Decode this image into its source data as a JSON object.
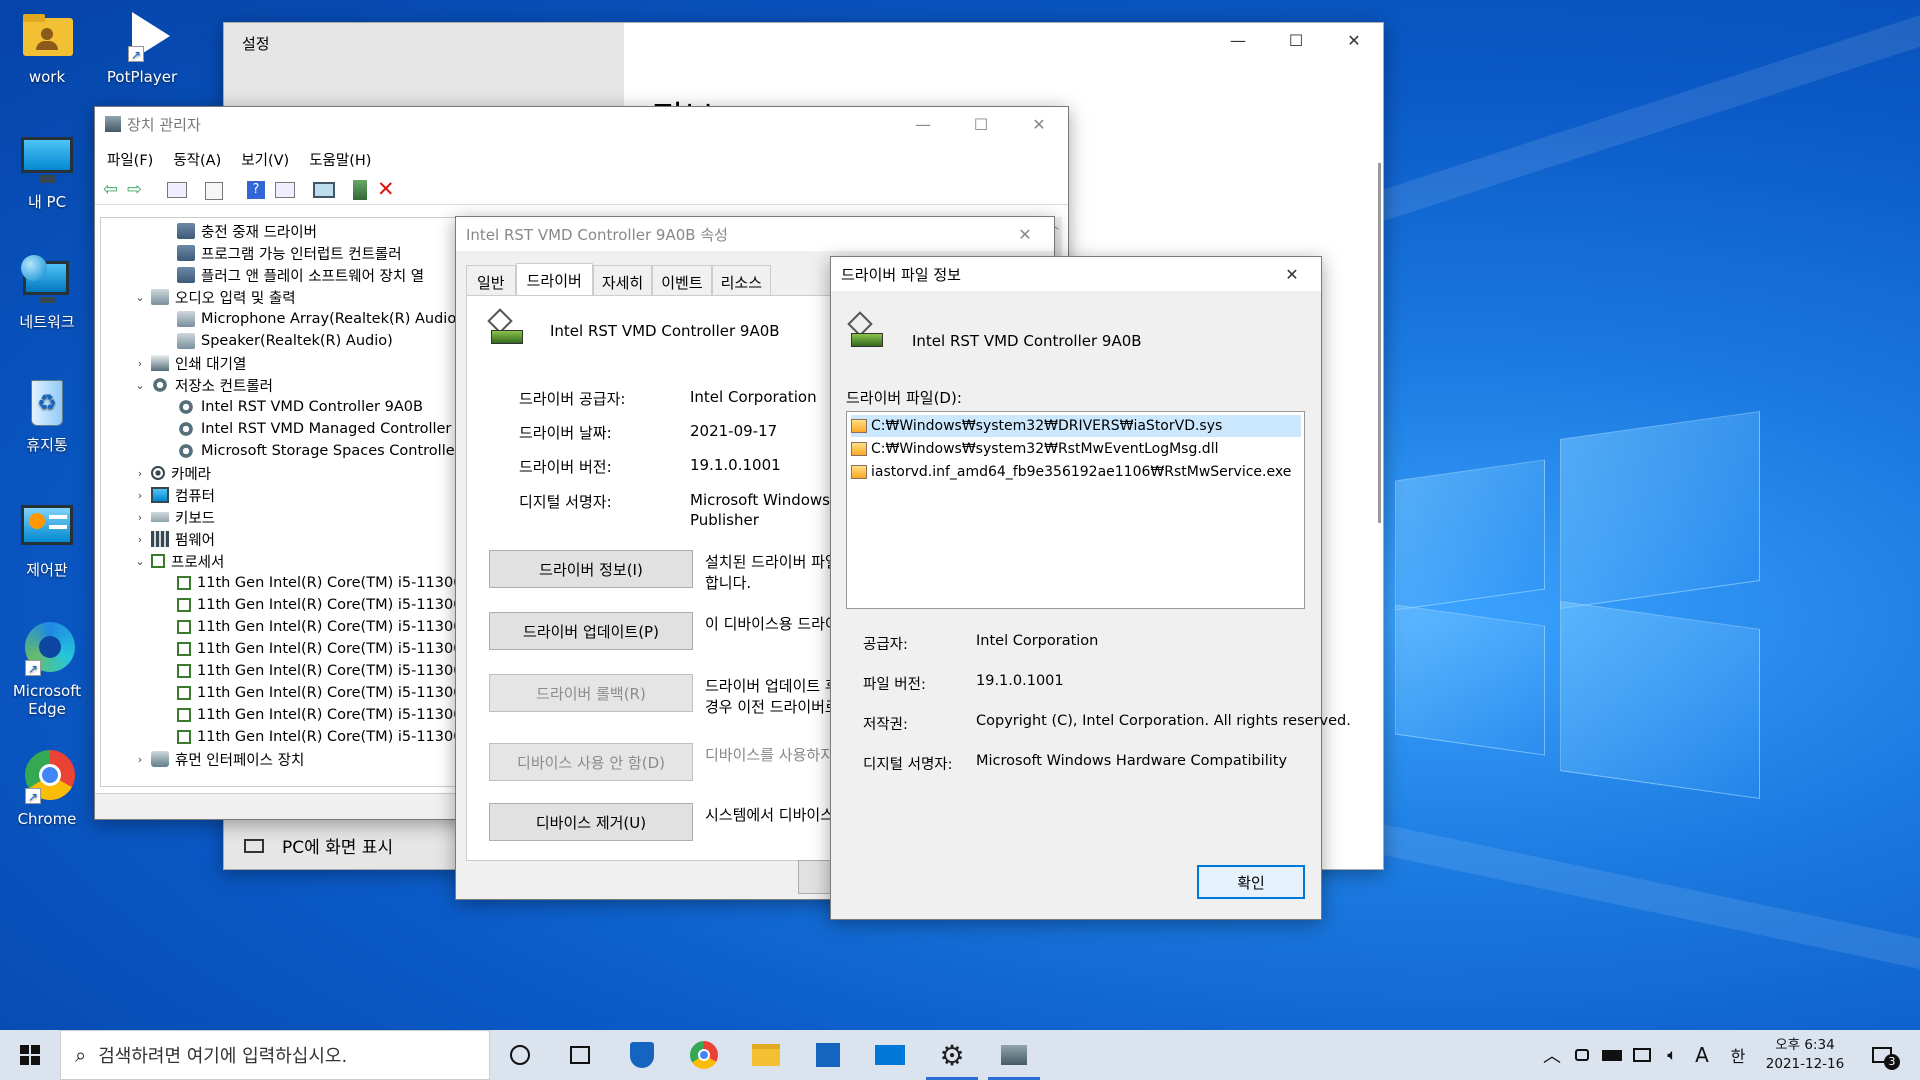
{
  "desktop_icons": [
    {
      "label": "work",
      "icon": "folder-user-icon"
    },
    {
      "label": "PotPlayer",
      "icon": "potplayer-icon"
    },
    {
      "label": "내 PC",
      "icon": "monitor-icon"
    },
    {
      "label": "네트워크",
      "icon": "network-globe-icon"
    },
    {
      "label": "휴지통",
      "icon": "recycle-bin-icon"
    },
    {
      "label": "제어판",
      "icon": "control-panel-icon"
    },
    {
      "label": "Microsoft Edge",
      "icon": "edge-icon"
    },
    {
      "label": "Chrome",
      "icon": "chrome-icon"
    }
  ],
  "settings_window": {
    "title": "설정",
    "heading_partial": "정보",
    "bottom_item": "PC에 화면 표시"
  },
  "device_manager": {
    "title": "장치 관리자",
    "menu": [
      "파일(F)",
      "동작(A)",
      "보기(V)",
      "도움말(H)"
    ],
    "tree": [
      {
        "indent": 2,
        "expander": "",
        "label": "충전 중재 드라이버",
        "icon": "device"
      },
      {
        "indent": 2,
        "expander": "",
        "label": "프로그램 가능 인터럽트 컨트롤러",
        "icon": "device"
      },
      {
        "indent": 2,
        "expander": "",
        "label": "플러그 앤 플레이 소프트웨어 장치 열",
        "icon": "device"
      },
      {
        "indent": 1,
        "expander": "v",
        "label": "오디오 입력 및 출력",
        "icon": "speaker"
      },
      {
        "indent": 2,
        "expander": "",
        "label": "Microphone Array(Realtek(R) Audio)",
        "icon": "speaker"
      },
      {
        "indent": 2,
        "expander": "",
        "label": "Speaker(Realtek(R) Audio)",
        "icon": "speaker"
      },
      {
        "indent": 1,
        "expander": ">",
        "label": "인쇄 대기열",
        "icon": "printer"
      },
      {
        "indent": 1,
        "expander": "v",
        "label": "저장소 컨트롤러",
        "icon": "gear"
      },
      {
        "indent": 2,
        "expander": "",
        "label": "Intel RST VMD Controller 9A0B",
        "icon": "gear"
      },
      {
        "indent": 2,
        "expander": "",
        "label": "Intel RST VMD Managed Controller 09",
        "icon": "gear"
      },
      {
        "indent": 2,
        "expander": "",
        "label": "Microsoft Storage Spaces Controller",
        "icon": "gear"
      },
      {
        "indent": 1,
        "expander": ">",
        "label": "카메라",
        "icon": "camera"
      },
      {
        "indent": 1,
        "expander": ">",
        "label": "컴퓨터",
        "icon": "monitor"
      },
      {
        "indent": 1,
        "expander": ">",
        "label": "키보드",
        "icon": "keyboard"
      },
      {
        "indent": 1,
        "expander": ">",
        "label": "펌웨어",
        "icon": "firmware"
      },
      {
        "indent": 1,
        "expander": "v",
        "label": "프로세서",
        "icon": "cpu"
      },
      {
        "indent": 2,
        "expander": "",
        "label": "11th Gen Intel(R) Core(TM) i5-11300H",
        "icon": "cpu"
      },
      {
        "indent": 2,
        "expander": "",
        "label": "11th Gen Intel(R) Core(TM) i5-11300H",
        "icon": "cpu"
      },
      {
        "indent": 2,
        "expander": "",
        "label": "11th Gen Intel(R) Core(TM) i5-11300H",
        "icon": "cpu"
      },
      {
        "indent": 2,
        "expander": "",
        "label": "11th Gen Intel(R) Core(TM) i5-11300H",
        "icon": "cpu"
      },
      {
        "indent": 2,
        "expander": "",
        "label": "11th Gen Intel(R) Core(TM) i5-11300H",
        "icon": "cpu"
      },
      {
        "indent": 2,
        "expander": "",
        "label": "11th Gen Intel(R) Core(TM) i5-11300H",
        "icon": "cpu"
      },
      {
        "indent": 2,
        "expander": "",
        "label": "11th Gen Intel(R) Core(TM) i5-11300H",
        "icon": "cpu"
      },
      {
        "indent": 2,
        "expander": "",
        "label": "11th Gen Intel(R) Core(TM) i5-11300H",
        "icon": "cpu"
      },
      {
        "indent": 1,
        "expander": ">",
        "label": "휴먼 인터페이스 장치",
        "icon": "hid"
      }
    ]
  },
  "properties_dialog": {
    "title": "Intel RST VMD Controller 9A0B 속성",
    "tabs": [
      "일반",
      "드라이버",
      "자세히",
      "이벤트",
      "리소스"
    ],
    "active_tab": "드라이버",
    "device_name": "Intel RST VMD Controller 9A0B",
    "fields": [
      {
        "label": "드라이버 공급자:",
        "value": "Intel Corporation"
      },
      {
        "label": "드라이버 날짜:",
        "value": "2021-09-17"
      },
      {
        "label": "드라이버 버전:",
        "value": "19.1.0.1001"
      },
      {
        "label": "디지털 서명자:",
        "value": "Microsoft Windows H"
      },
      {
        "label": "",
        "value": "Publisher"
      }
    ],
    "buttons": [
      {
        "label": "드라이버 정보(I)",
        "desc": "설치된 드라이버 파일",
        "desc2": "합니다.",
        "enabled": true
      },
      {
        "label": "드라이버 업데이트(P)",
        "desc": "이 디바이스용 드라이",
        "desc2": "",
        "enabled": true
      },
      {
        "label": "드라이버 롤백(R)",
        "desc": "드라이버 업데이트 후",
        "desc2": "경우 이전 드라이버로",
        "enabled": false
      },
      {
        "label": "디바이스 사용 안 함(D)",
        "desc": "디바이스를 사용하지",
        "desc2": "",
        "enabled": false
      },
      {
        "label": "디바이스 제거(U)",
        "desc": "시스템에서 디바이스",
        "desc2": "",
        "enabled": true
      }
    ]
  },
  "file_info_dialog": {
    "title": "드라이버 파일 정보",
    "device_name": "Intel RST VMD Controller 9A0B",
    "files_label": "드라이버 파일(D):",
    "files": [
      "C:₩Windows₩system32₩DRIVERS₩iaStorVD.sys",
      "C:₩Windows₩system32₩RstMwEventLogMsg.dll",
      "iastorvd.inf_amd64_fb9e356192ae1106₩RstMwService.exe"
    ],
    "selected_file_index": 0,
    "details": [
      {
        "label": "공급자:",
        "value": "Intel Corporation"
      },
      {
        "label": "파일 버전:",
        "value": "19.1.0.1001"
      },
      {
        "label": "저작권:",
        "value": "Copyright (C), Intel Corporation. All rights reserved."
      },
      {
        "label": "디지털 서명자:",
        "value": "Microsoft Windows Hardware Compatibility"
      }
    ],
    "ok_label": "확인"
  },
  "taskbar": {
    "search_placeholder": "검색하려면 여기에 입력하십시오.",
    "ime_mode": "A",
    "ime_lang": "한",
    "time": "오후 6:34",
    "date": "2021-12-16",
    "notification_count": "3",
    "apps": [
      "cortana-icon",
      "task-view-icon",
      "security-icon",
      "chrome-icon",
      "file-explorer-icon",
      "store-icon",
      "mail-icon",
      "settings-icon",
      "device-manager-icon"
    ]
  }
}
